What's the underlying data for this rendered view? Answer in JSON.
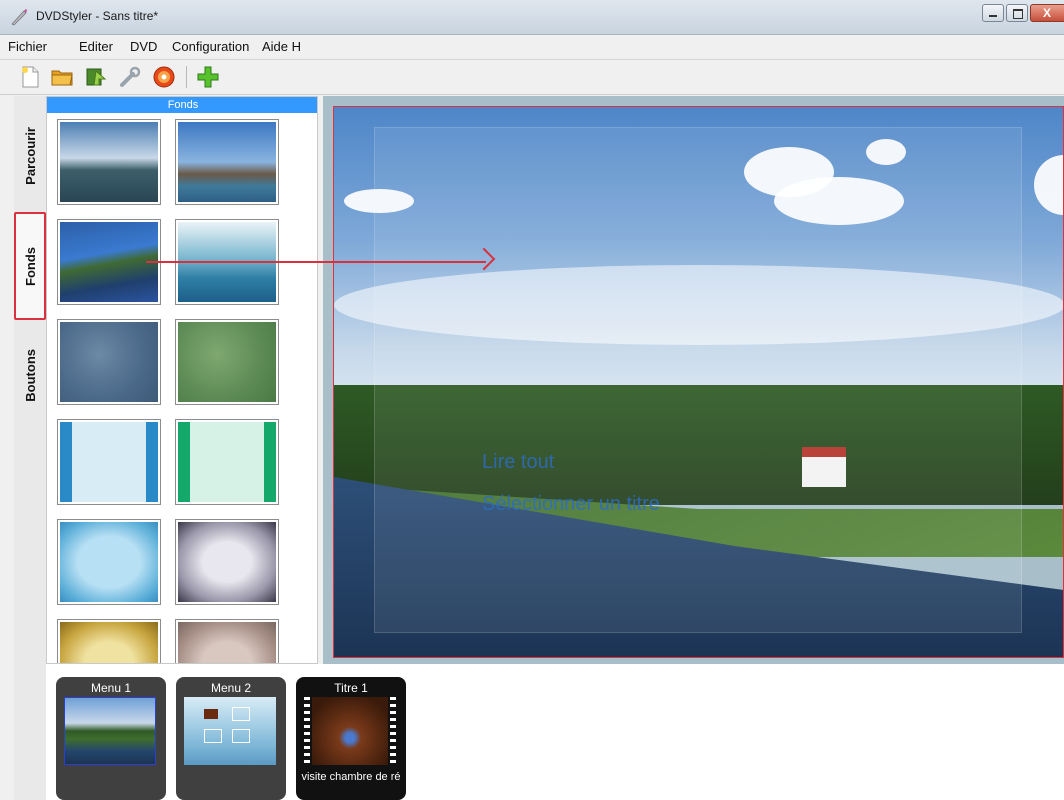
{
  "window": {
    "title": "DVDStyler - Sans titre*"
  },
  "menubar": {
    "items": [
      "Fichier",
      "Editer",
      "DVD",
      "Configuration",
      "Aide H"
    ]
  },
  "toolbar": {
    "icons": [
      "new-file-icon",
      "open-folder-icon",
      "burn-icon",
      "settings-wrench-icon",
      "dvd-disc-icon",
      "add-plus-icon"
    ]
  },
  "sidebar": {
    "tabs": [
      "Parcourir",
      "Fonds",
      "Boutons"
    ],
    "selected": "Fonds"
  },
  "gallery": {
    "header": "Fonds"
  },
  "canvas": {
    "menu_lines": [
      "Lire tout",
      "Sélectionner un titre"
    ]
  },
  "titleset": {
    "cards": [
      {
        "label": "Menu 1",
        "sub": ""
      },
      {
        "label": "Menu 2",
        "sub": ""
      },
      {
        "label": "Titre 1",
        "sub": "visite chambre de ré"
      }
    ]
  },
  "colors": {
    "accent": "#3399ff",
    "highlight": "#d9323e"
  }
}
